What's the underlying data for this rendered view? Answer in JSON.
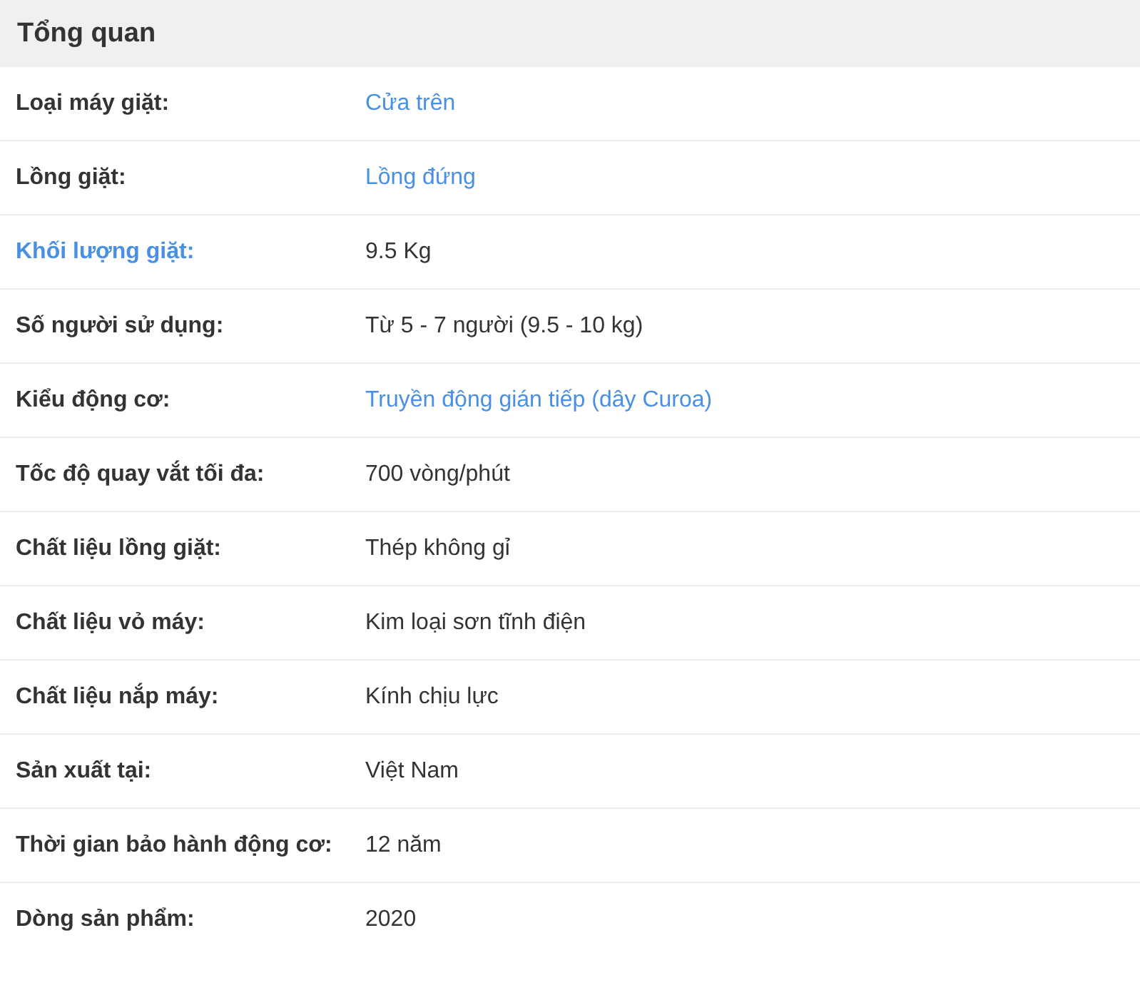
{
  "title": "Tổng quan",
  "rows": [
    {
      "label": "Loại máy giặt:",
      "label_link": false,
      "value": "Cửa trên",
      "value_link": true
    },
    {
      "label": "Lồng giặt:",
      "label_link": false,
      "value": "Lồng đứng",
      "value_link": true
    },
    {
      "label": "Khối lượng giặt:",
      "label_link": true,
      "value": "9.5 Kg",
      "value_link": false
    },
    {
      "label": "Số người sử dụng:",
      "label_link": false,
      "value": "Từ 5 - 7 người (9.5 - 10 kg)",
      "value_link": false
    },
    {
      "label": "Kiểu động cơ:",
      "label_link": false,
      "value": "Truyền động gián tiếp (dây Curoa)",
      "value_link": true
    },
    {
      "label": "Tốc độ quay vắt tối đa:",
      "label_link": false,
      "value": "700 vòng/phút",
      "value_link": false
    },
    {
      "label": "Chất liệu lồng giặt:",
      "label_link": false,
      "value": "Thép không gỉ",
      "value_link": false
    },
    {
      "label": "Chất liệu vỏ máy:",
      "label_link": false,
      "value": "Kim loại sơn tĩnh điện",
      "value_link": false
    },
    {
      "label": "Chất liệu nắp máy:",
      "label_link": false,
      "value": "Kính chịu lực",
      "value_link": false
    },
    {
      "label": "Sản xuất tại:",
      "label_link": false,
      "value": "Việt Nam",
      "value_link": false
    },
    {
      "label": "Thời gian bảo hành động cơ:",
      "label_link": false,
      "value": "12 năm",
      "value_link": false
    },
    {
      "label": "Dòng sản phẩm:",
      "label_link": false,
      "value": "2020",
      "value_link": false
    }
  ]
}
